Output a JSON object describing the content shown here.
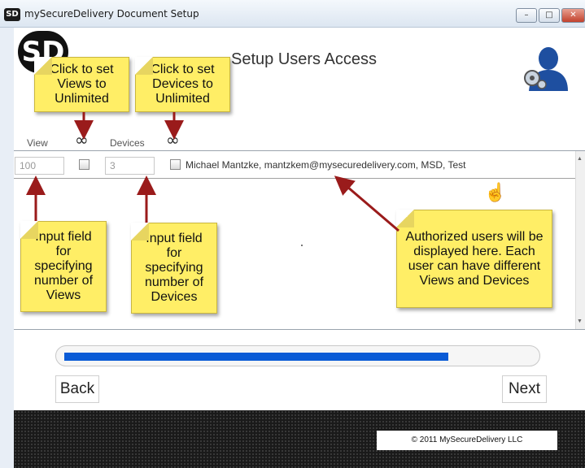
{
  "window": {
    "icon": "SD",
    "title": "mySecureDelivery Document Setup",
    "controls": [
      "minimize-icon",
      "maximize-icon",
      "close-icon"
    ]
  },
  "logo": {
    "text": "SD"
  },
  "page_title": "Setup Users Access",
  "header_icons": {
    "user_settings": "user-gear-icon"
  },
  "columns": {
    "view": "View",
    "devices": "Devices",
    "unlimited_symbol": "∞"
  },
  "users": [
    {
      "views": "100",
      "devices": "3",
      "label": "Michael Mantzke, mantzkem@mysecuredelivery.com, MSD, Test"
    }
  ],
  "callouts": {
    "views_unlimited": "Click to set Views to Unlimited",
    "devices_unlimited": "Click to set Devices to Unlimited",
    "views_input": "Input field for specifying number of Views",
    "devices_input": "Input field for specifying number of Devices",
    "authorized_users": "Authorized users will be displayed here.  Each user can have different Views and Devices"
  },
  "progress": {
    "value": 0.82
  },
  "buttons": {
    "back": "Back",
    "next": "Next"
  },
  "footer": {
    "copyright": "© 2011 MySecureDelivery LLC"
  },
  "colors": {
    "note": "#ffee66",
    "arrow": "#9a1b1b",
    "progress": "#0a5bd6",
    "footer": "#1a1a1a"
  }
}
